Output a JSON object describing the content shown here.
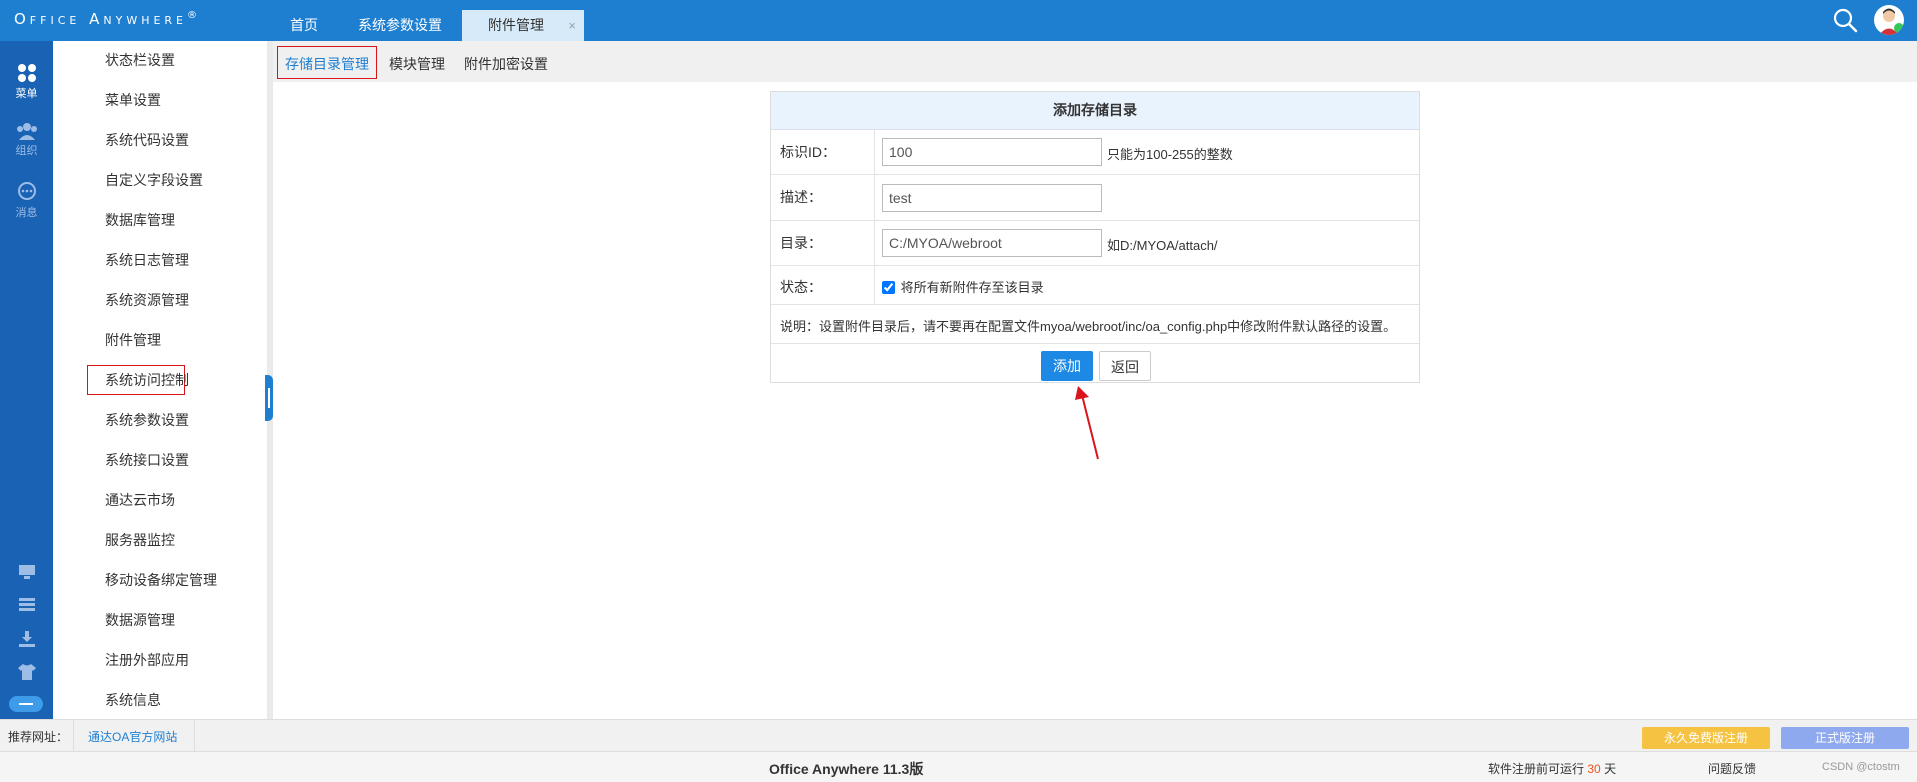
{
  "app": {
    "logo_text": "Office Anywhere",
    "logo_mark": "®"
  },
  "top_tabs": [
    {
      "label": "首页"
    },
    {
      "label": "系统参数设置"
    },
    {
      "label": "附件管理",
      "close": "×"
    }
  ],
  "rail": [
    {
      "label": "菜单",
      "icon": "grid-icon"
    },
    {
      "label": "组织",
      "icon": "users-icon"
    },
    {
      "label": "消息",
      "icon": "message-icon"
    }
  ],
  "sidebar": {
    "items": [
      {
        "label": "状态栏设置"
      },
      {
        "label": "菜单设置"
      },
      {
        "label": "系统代码设置"
      },
      {
        "label": "自定义字段设置"
      },
      {
        "label": "数据库管理"
      },
      {
        "label": "系统日志管理"
      },
      {
        "label": "系统资源管理"
      },
      {
        "label": "附件管理"
      },
      {
        "label": "系统访问控制"
      },
      {
        "label": "系统参数设置"
      },
      {
        "label": "系统接口设置"
      },
      {
        "label": "通达云市场"
      },
      {
        "label": "服务器监控"
      },
      {
        "label": "移动设备绑定管理"
      },
      {
        "label": "数据源管理"
      },
      {
        "label": "注册外部应用"
      },
      {
        "label": "系统信息"
      }
    ]
  },
  "subtabs": [
    {
      "label": "存储目录管理"
    },
    {
      "label": "模块管理"
    },
    {
      "label": "附件加密设置"
    }
  ],
  "form": {
    "title": "添加存储目录",
    "id_label": "标识ID：",
    "id_value": "100",
    "id_hint": "只能为100-255的整数",
    "desc_label": "描述：",
    "desc_value": "test",
    "dir_label": "目录：",
    "dir_value": "C:/MYOA/webroot",
    "dir_hint": "如D:/MYOA/attach/",
    "status_label": "状态：",
    "status_checkbox_label": "将所有新附件存至该目录",
    "status_checked": true,
    "note": "说明：设置附件目录后，请不要再在配置文件myoa/webroot/inc/oa_config.php中修改附件默认路径的设置。",
    "add_button": "添加",
    "back_button": "返回"
  },
  "footer": {
    "recommend_label": "推荐网址：",
    "recommend_link": "通达OA官方网站",
    "free_reg_button": "永久免费版注册",
    "official_reg_button": "正式版注册",
    "version": "Office Anywhere 11.3版",
    "trial_prefix": "软件注册前可运行",
    "trial_days": "30",
    "trial_suffix": "天",
    "feedback": "问题反馈",
    "watermark": "CSDN @ctostm"
  },
  "colors": {
    "primary": "#1e7fd1",
    "highlight_box": "#d9141a",
    "annotation_arrow": "#d9141a",
    "free_button": "#f5c242",
    "official_button": "#8fa9ee",
    "trial_days": "#e8541c"
  }
}
